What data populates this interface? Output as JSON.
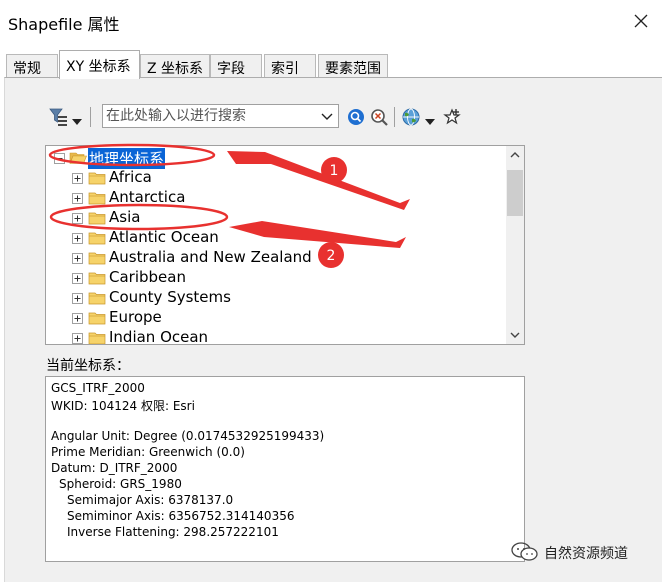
{
  "window": {
    "title": "Shapefile 属性",
    "close_label": "✕"
  },
  "tabs": [
    {
      "label": "常规"
    },
    {
      "label": "XY 坐标系"
    },
    {
      "label": "Z 坐标系"
    },
    {
      "label": "字段"
    },
    {
      "label": "索引"
    },
    {
      "label": "要素范围"
    }
  ],
  "active_tab": "XY 坐标系",
  "toolbar": {
    "filter_icon": "filter-icon",
    "search_placeholder": "在此处输入以进行搜索",
    "search_value": "",
    "search_icon": "search-icon",
    "clear_search_icon": "clear-search-icon",
    "globe_icon": "globe-icon",
    "add_favorite_icon": "add-favorite-icon"
  },
  "tree": {
    "root": {
      "label": "地理坐标系",
      "selected": true,
      "expanded": true
    },
    "children": [
      {
        "label": "Africa"
      },
      {
        "label": "Antarctica"
      },
      {
        "label": "Asia"
      },
      {
        "label": "Atlantic Ocean"
      },
      {
        "label": "Australia and New Zealand"
      },
      {
        "label": "Caribbean"
      },
      {
        "label": "County Systems"
      },
      {
        "label": "Europe"
      },
      {
        "label": "Indian Ocean"
      }
    ]
  },
  "current_cs": {
    "label": "当前坐标系：",
    "lines": [
      "GCS_ITRF_2000",
      "WKID: 104124 权限: Esri",
      "",
      "Angular Unit: Degree (0.0174532925199433)",
      "Prime Meridian: Greenwich (0.0)",
      "Datum: D_ITRF_2000",
      "  Spheroid: GRS_1980",
      "    Semimajor Axis: 6378137.0",
      "    Semiminor Axis: 6356752.314140356",
      "    Inverse Flattening: 298.257222101"
    ]
  },
  "annotations": {
    "marker_1": "1",
    "marker_2": "2",
    "color": "#e8312f"
  },
  "watermark": {
    "text": "自然资源频道",
    "icon": "wechat-icon"
  },
  "colors": {
    "selection": "#0a64d6",
    "folder": "#f3c74f",
    "folder_edge": "#c9972c"
  }
}
